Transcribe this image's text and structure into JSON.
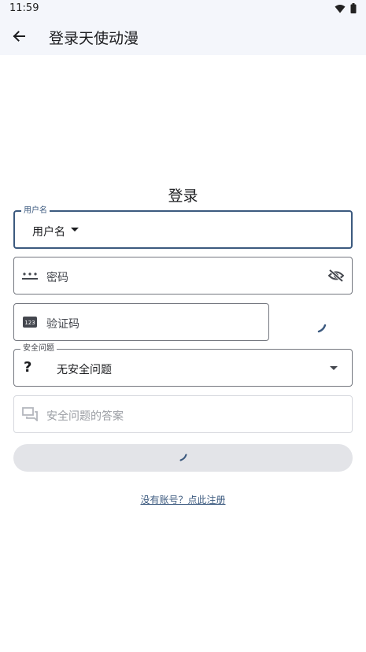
{
  "status_bar": {
    "time": "11:59"
  },
  "app_bar": {
    "title": "登录天使动漫"
  },
  "form": {
    "title": "登录",
    "username": {
      "label": "用户名",
      "value": "用户名"
    },
    "password": {
      "placeholder": "密码"
    },
    "captcha": {
      "placeholder": "验证码"
    },
    "security_question": {
      "label": "安全问题",
      "value": "无安全问题"
    },
    "answer": {
      "placeholder": "安全问题的答案"
    },
    "register_link": "没有账号？点此注册"
  },
  "colors": {
    "primary": "#3c5a7f",
    "surface": "#f4f6fb",
    "outline": "#74777f",
    "disabled_button": "#e3e4e8"
  }
}
